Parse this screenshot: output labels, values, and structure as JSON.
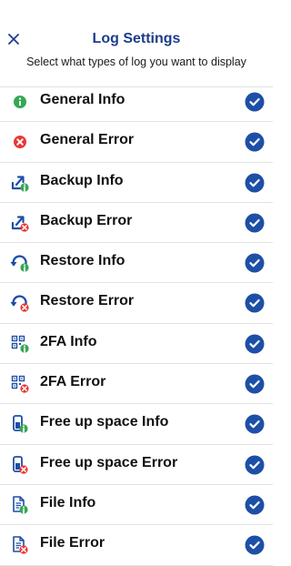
{
  "header": {
    "title": "Log Settings",
    "subtitle": "Select what types of log you want to display",
    "close_icon": "close-icon"
  },
  "colors": {
    "accent": "#1c3e8a",
    "check": "#1e4fa6",
    "info": "#34a853",
    "error": "#e53935"
  },
  "log_types": [
    {
      "label": "General Info",
      "icon": "info-icon",
      "checked": true
    },
    {
      "label": "General Error",
      "icon": "error-icon",
      "checked": true
    },
    {
      "label": "Backup Info",
      "icon": "backup-info-icon",
      "checked": true
    },
    {
      "label": "Backup Error",
      "icon": "backup-error-icon",
      "checked": true
    },
    {
      "label": "Restore Info",
      "icon": "restore-info-icon",
      "checked": true
    },
    {
      "label": "Restore Error",
      "icon": "restore-error-icon",
      "checked": true
    },
    {
      "label": "2FA Info",
      "icon": "2fa-info-icon",
      "checked": true
    },
    {
      "label": "2FA Error",
      "icon": "2fa-error-icon",
      "checked": true
    },
    {
      "label": "Free up space Info",
      "icon": "free-space-info-icon",
      "checked": true
    },
    {
      "label": "Free up space Error",
      "icon": "free-space-error-icon",
      "checked": true
    },
    {
      "label": "File Info",
      "icon": "file-info-icon",
      "checked": true
    },
    {
      "label": "File Error",
      "icon": "file-error-icon",
      "checked": true
    }
  ]
}
